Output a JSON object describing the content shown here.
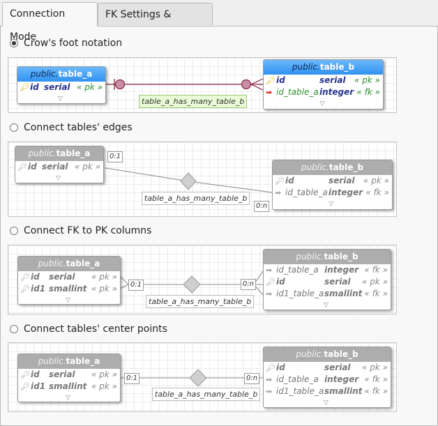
{
  "tabs": [
    {
      "label": "Connection Mode",
      "active": true
    },
    {
      "label": "FK Settings & Patterns",
      "active": false
    }
  ],
  "options": [
    {
      "label": "Crow's foot notation",
      "selected": true,
      "relationship_label": "table_a_has_many_table_b",
      "table_a": {
        "schema": "public.",
        "name": "table_a",
        "columns": [
          {
            "icon": "primary-key-icon",
            "name": "id",
            "type": "serial",
            "alias": "« pk »"
          }
        ]
      },
      "table_b": {
        "schema": "public.",
        "name": "table_b",
        "columns": [
          {
            "icon": "primary-key-icon",
            "name": "id",
            "type": "serial",
            "alias": "« pk »"
          },
          {
            "icon": "foreign-key-icon",
            "name": "id_table_a",
            "type": "integer",
            "alias": "« fk »"
          }
        ]
      }
    },
    {
      "label": "Connect tables' edges",
      "selected": false,
      "relationship_label": "table_a_has_many_table_b",
      "card_a": "0:1",
      "card_b": "0:n",
      "table_a": {
        "schema": "public.",
        "name": "table_a",
        "columns": [
          {
            "name": "id",
            "type": "serial",
            "alias": "« pk »"
          }
        ]
      },
      "table_b": {
        "schema": "public.",
        "name": "table_b",
        "columns": [
          {
            "name": "id",
            "type": "serial",
            "alias": "« pk »"
          },
          {
            "name": "id_table_a",
            "type": "integer",
            "alias": "« fk »"
          }
        ]
      }
    },
    {
      "label": "Connect FK to PK columns",
      "selected": false,
      "relationship_label": "table_a_has_many_table_b",
      "card_a": "0:1",
      "card_b": "0:n",
      "table_a": {
        "schema": "public.",
        "name": "table_a",
        "columns": [
          {
            "name": "id",
            "type": "serial",
            "alias": "« pk »"
          },
          {
            "name": "id1",
            "type": "smallint",
            "alias": "« pk »"
          }
        ]
      },
      "table_b": {
        "schema": "public.",
        "name": "table_b",
        "columns": [
          {
            "name": "id_table_a",
            "type": "integer",
            "alias": "« fk »"
          },
          {
            "name": "id",
            "type": "serial",
            "alias": "« pk »"
          },
          {
            "name": "id1_table_a",
            "type": "smallint",
            "alias": "« fk »"
          }
        ]
      }
    },
    {
      "label": "Connect tables' center points",
      "selected": false,
      "relationship_label": "table_a_has_many_table_b",
      "card_a": "0:1",
      "card_b": "0:n",
      "table_a": {
        "schema": "public.",
        "name": "table_a",
        "columns": [
          {
            "name": "id",
            "type": "serial",
            "alias": "« pk »"
          },
          {
            "name": "id1",
            "type": "smallint",
            "alias": "« pk »"
          }
        ]
      },
      "table_b": {
        "schema": "public.",
        "name": "table_b",
        "columns": [
          {
            "name": "id",
            "type": "serial",
            "alias": "« pk »"
          },
          {
            "name": "id_table_a",
            "type": "integer",
            "alias": "« fk »"
          },
          {
            "name": "id1_table_a",
            "type": "smallint",
            "alias": "« fk »"
          }
        ]
      }
    }
  ],
  "colors": {
    "table_header_blue": "#2f92f1",
    "table_header_grey": "#adadad",
    "relationship_line_crowsfoot": "#8a2040",
    "relationship_line": "#8c8c8c",
    "label_green_bg": "#eafbd8"
  },
  "icons": {
    "pk": "primary-key-icon",
    "fk": "foreign-key-icon",
    "expand": "chevron-down-icon"
  }
}
